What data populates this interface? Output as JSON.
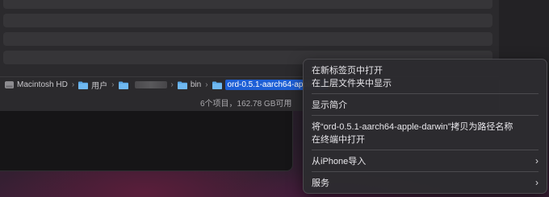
{
  "path_bar": {
    "items": [
      {
        "label": "Macintosh HD",
        "icon": "hard-drive-icon"
      },
      {
        "label": "用户",
        "icon": "folder-icon"
      },
      {
        "label": "",
        "icon": "folder-icon"
      },
      {
        "label": "bin",
        "icon": "folder-icon"
      },
      {
        "label": "ord-0.5.1-aarch64-apple-da",
        "icon": "folder-icon"
      }
    ],
    "separator": "›"
  },
  "status_bar": {
    "text": "6个项目，162.78 GB可用"
  },
  "context_menu": {
    "groups": [
      [
        "在新标签页中打开",
        "在上层文件夹中显示"
      ],
      [
        "显示简介"
      ],
      [
        "将“ord-0.5.1-aarch64-apple-darwin”拷贝为路径名称",
        "在终端中打开"
      ],
      [
        "从iPhone导入"
      ],
      [
        "服务"
      ]
    ],
    "submenu_arrow": "›"
  },
  "colors": {
    "selection": "#1d5fd6",
    "folder": "#5aa8e6",
    "menu_bg": "#2c2b2f"
  }
}
